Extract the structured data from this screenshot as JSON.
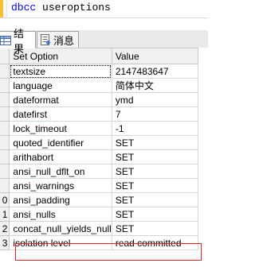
{
  "editor": {
    "keyword": "dbcc",
    "argument": "useroptions"
  },
  "tabs": [
    {
      "label": "结果",
      "icon": "grid-icon",
      "active": true
    },
    {
      "label": "消息",
      "icon": "messages-icon",
      "active": false
    }
  ],
  "grid": {
    "columns": [
      "Set Option",
      "Value"
    ],
    "rows": [
      {
        "num": "",
        "option": "textsize",
        "value": "2147483647"
      },
      {
        "num": "",
        "option": "language",
        "value": "简体中文"
      },
      {
        "num": "",
        "option": "dateformat",
        "value": "ymd"
      },
      {
        "num": "",
        "option": "datefirst",
        "value": "7"
      },
      {
        "num": "",
        "option": "lock_timeout",
        "value": "-1"
      },
      {
        "num": "",
        "option": "quoted_identifier",
        "value": "SET"
      },
      {
        "num": "",
        "option": "arithabort",
        "value": "SET"
      },
      {
        "num": "",
        "option": "ansi_null_dflt_on",
        "value": "SET"
      },
      {
        "num": "",
        "option": "ansi_warnings",
        "value": "SET"
      },
      {
        "num": "0",
        "option": "ansi_padding",
        "value": "SET"
      },
      {
        "num": "1",
        "option": "ansi_nulls",
        "value": "SET"
      },
      {
        "num": "2",
        "option": "concat_null_yields_null",
        "value": "SET"
      },
      {
        "num": "3",
        "option": "isolation level",
        "value": "read committed"
      }
    ]
  },
  "colors": {
    "keyword": "#0000ff",
    "highlight_border": "#e02020"
  }
}
